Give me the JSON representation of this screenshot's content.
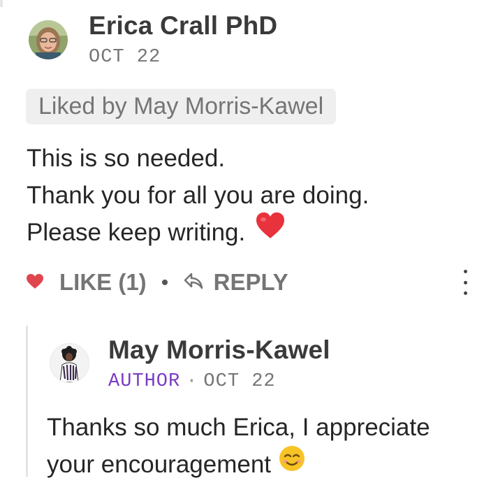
{
  "comment": {
    "author": "Erica Crall PhD",
    "date": "OCT 22",
    "liked_by": "Liked by May Morris-Kawel",
    "body_lines": [
      "This is so needed.",
      "Thank you for all you are doing.",
      "Please keep writing."
    ],
    "body_emoji": "red-heart-emoji",
    "like_label": "LIKE (1)",
    "reply_label": "REPLY",
    "like_color": "#e0464e"
  },
  "reply": {
    "author": "May Morris-Kawel",
    "role": "AUTHOR",
    "separator": "·",
    "date": "OCT 22",
    "body_lines": [
      "Thanks so much Erica, I appreciate",
      "your encouragement"
    ],
    "body_emoji": "smiling-face-emoji",
    "role_color": "#7a3cc4"
  }
}
